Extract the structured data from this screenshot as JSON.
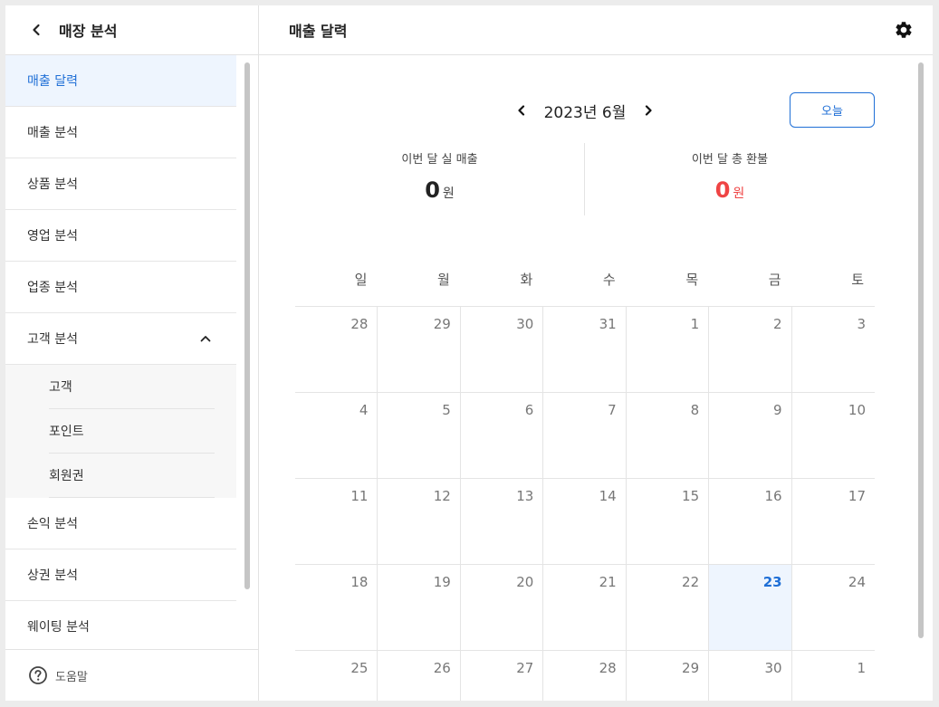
{
  "sidebar": {
    "title": "매장 분석",
    "items": [
      {
        "label": "매출 달력",
        "active": true
      },
      {
        "label": "매출 분석"
      },
      {
        "label": "상품 분석"
      },
      {
        "label": "영업 분석"
      },
      {
        "label": "업종 분석"
      },
      {
        "label": "고객 분석",
        "expanded": true
      }
    ],
    "sub_items": [
      "고객",
      "포인트",
      "회원권"
    ],
    "items_after": [
      "손익 분석",
      "상권 분석",
      "웨이팅 분석"
    ],
    "help_label": "도움말"
  },
  "main": {
    "title": "매출 달력",
    "month_label": "2023년 6월",
    "today_button": "오늘",
    "summary": {
      "sales_label": "이번 달 실 매출",
      "sales_value": "0",
      "sales_unit": "원",
      "refund_label": "이번 달 총 환불",
      "refund_value": "0",
      "refund_unit": "원"
    },
    "weekdays": [
      "일",
      "월",
      "화",
      "수",
      "목",
      "금",
      "토"
    ],
    "weeks": [
      [
        "28",
        "29",
        "30",
        "31",
        "1",
        "2",
        "3"
      ],
      [
        "4",
        "5",
        "6",
        "7",
        "8",
        "9",
        "10"
      ],
      [
        "11",
        "12",
        "13",
        "14",
        "15",
        "16",
        "17"
      ],
      [
        "18",
        "19",
        "20",
        "21",
        "22",
        "23",
        "24"
      ],
      [
        "25",
        "26",
        "27",
        "28",
        "29",
        "30",
        "1"
      ]
    ],
    "today_date": "23"
  },
  "colors": {
    "accent": "#1f6fd6",
    "active_bg": "#eef5fe",
    "refund": "#ef4444"
  },
  "icons": {
    "back": "chevron-left-icon",
    "settings": "gear-icon",
    "collapse": "chevron-up-icon",
    "help": "question-circle-icon",
    "prev_month": "chevron-left-icon",
    "next_month": "chevron-right-icon"
  }
}
